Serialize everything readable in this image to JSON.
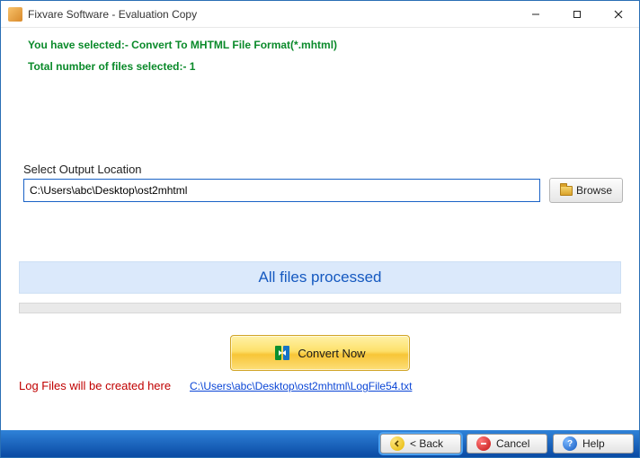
{
  "window": {
    "title": "Fixvare Software - Evaluation Copy"
  },
  "info": {
    "line1": "You have selected:- Convert To MHTML File Format(*.mhtml)",
    "line2": "Total number of files selected:- 1"
  },
  "output": {
    "label": "Select Output Location",
    "path": "C:\\Users\\abc\\Desktop\\ost2mhtml",
    "browse_label": "Browse"
  },
  "status": {
    "text": "All files processed"
  },
  "convert": {
    "label": "Convert Now"
  },
  "log": {
    "label": "Log Files will be created here",
    "link": "C:\\Users\\abc\\Desktop\\ost2mhtml\\LogFile54.txt"
  },
  "footer": {
    "back": "< Back",
    "cancel": "Cancel",
    "help": "Help"
  }
}
